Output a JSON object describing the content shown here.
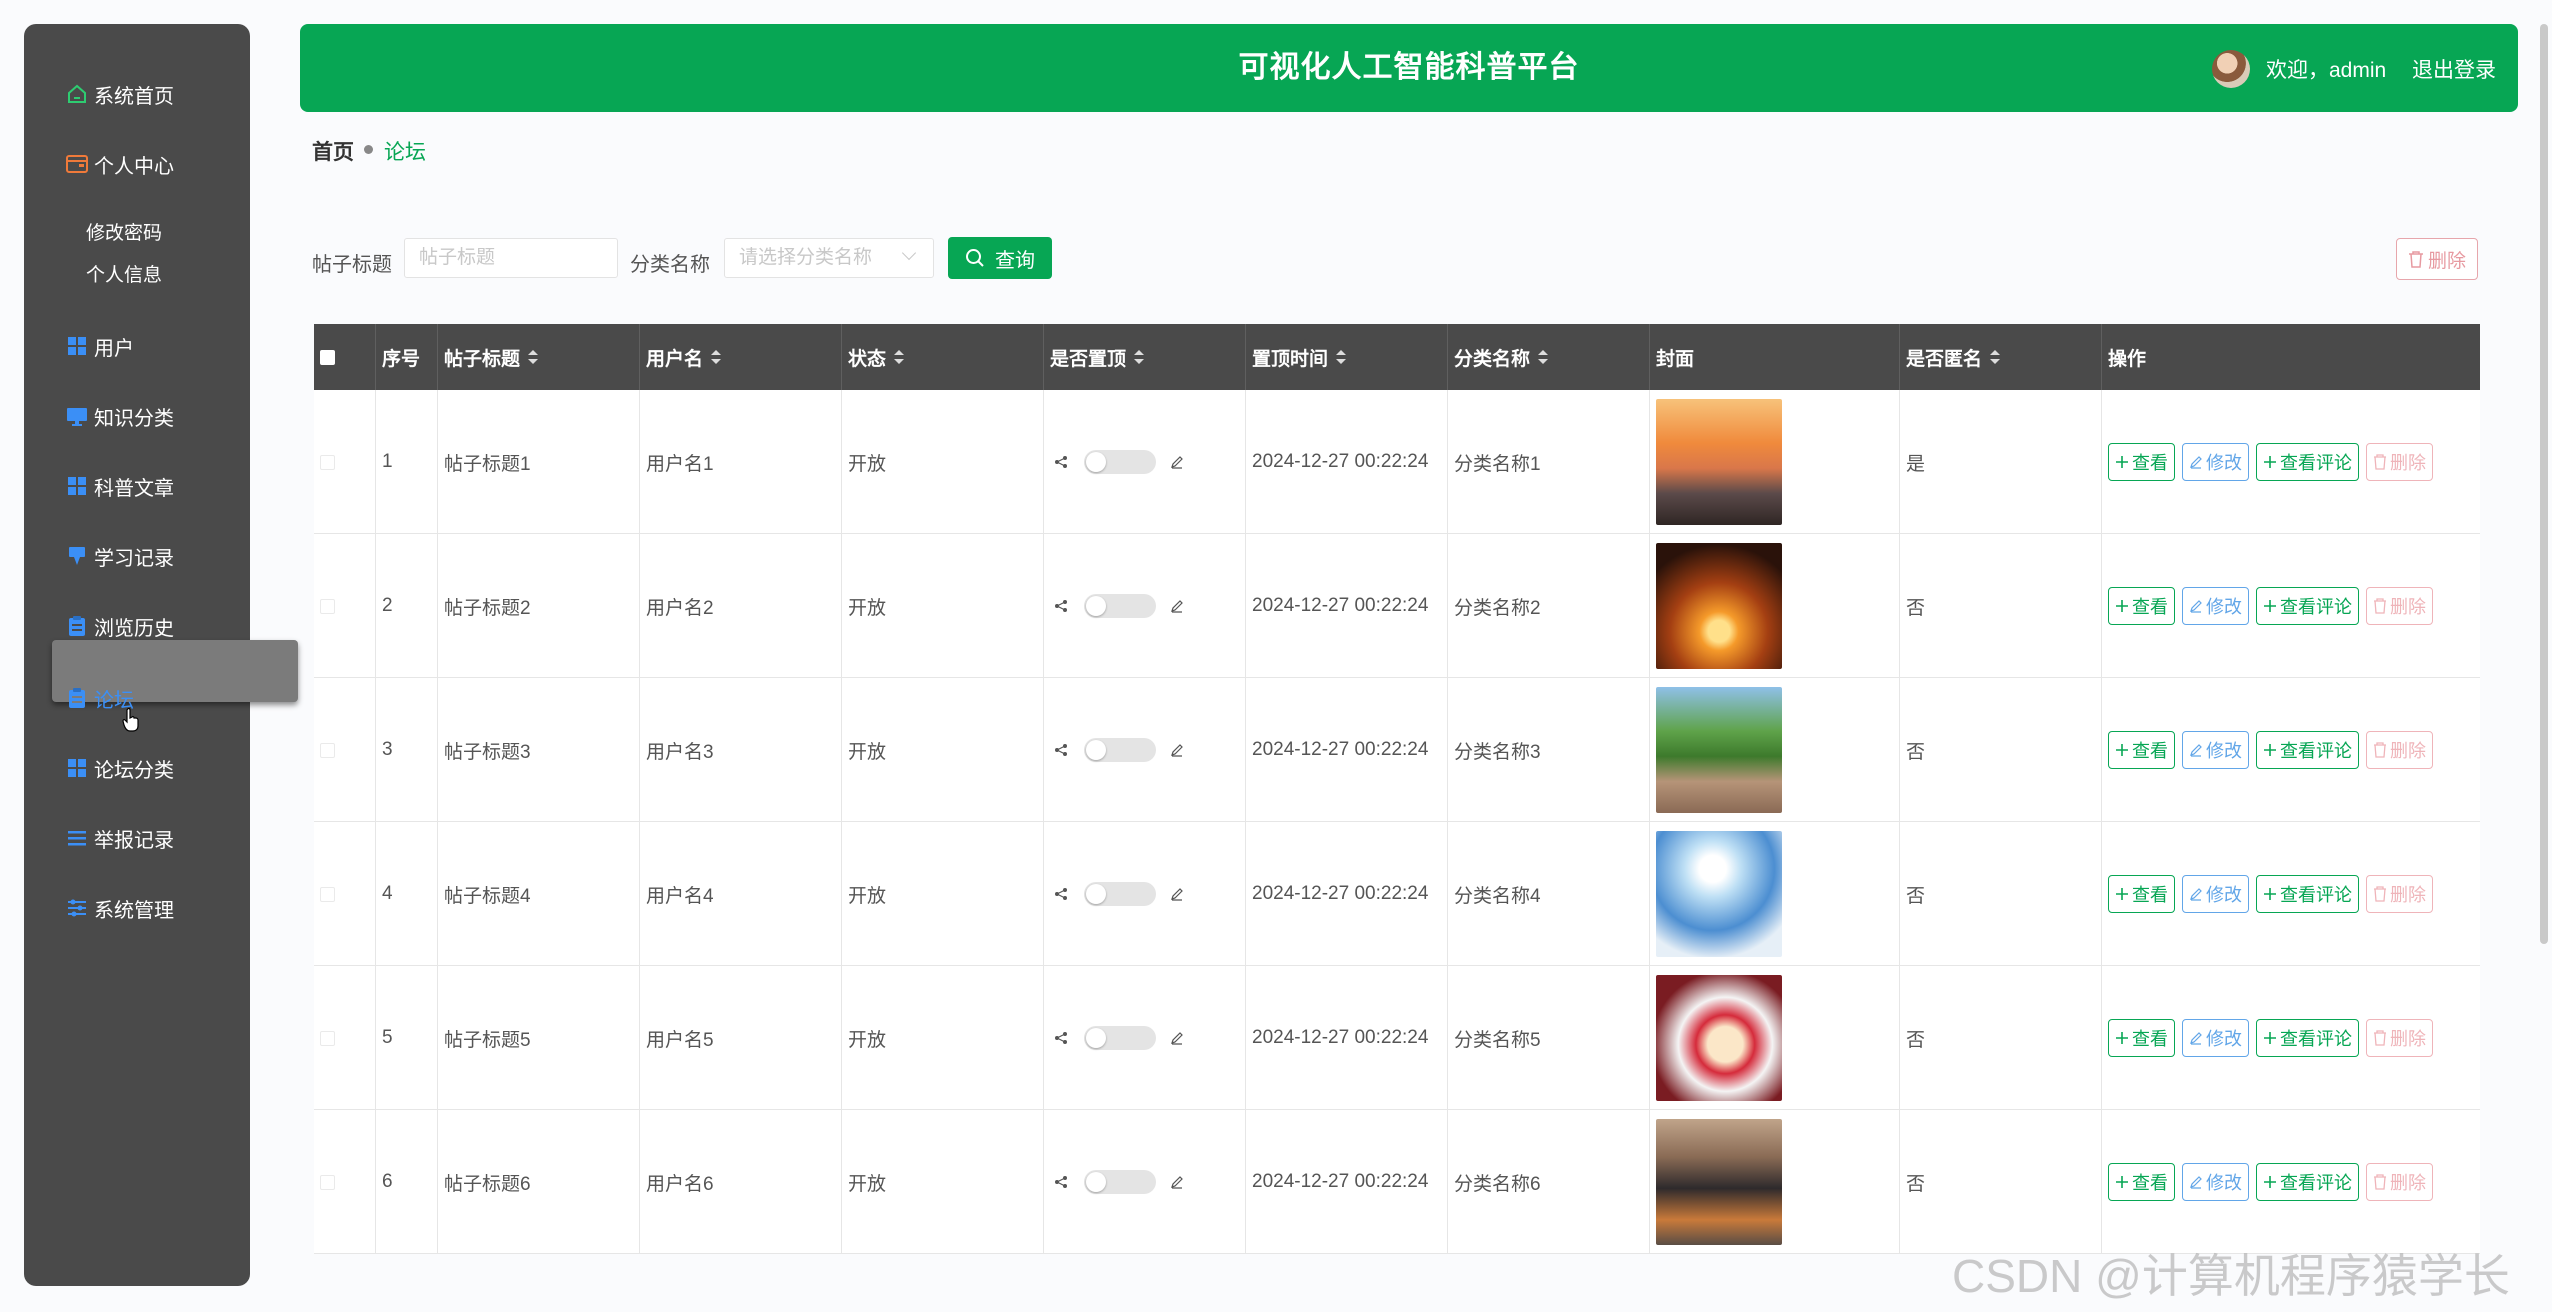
{
  "sidebar": {
    "items": [
      {
        "label": "系统首页",
        "icon": "home-icon"
      },
      {
        "label": "个人中心",
        "icon": "wallet-icon"
      },
      {
        "label": "用户",
        "icon": "grid-icon"
      },
      {
        "label": "知识分类",
        "icon": "monitor-icon"
      },
      {
        "label": "科普文章",
        "icon": "grid-icon"
      },
      {
        "label": "学习记录",
        "icon": "pin-icon"
      },
      {
        "label": "浏览历史",
        "icon": "clipboard-icon"
      },
      {
        "label": "论坛",
        "icon": "clipboard-icon"
      },
      {
        "label": "论坛分类",
        "icon": "grid-icon"
      },
      {
        "label": "举报记录",
        "icon": "list-icon"
      },
      {
        "label": "系统管理",
        "icon": "sliders-icon"
      }
    ],
    "subitems": [
      "修改密码",
      "个人信息"
    ],
    "active_index": 7
  },
  "header": {
    "title": "可视化人工智能科普平台",
    "welcome": "欢迎，admin",
    "logout": "退出登录"
  },
  "breadcrumb": {
    "home": "首页",
    "current": "论坛"
  },
  "search": {
    "title_label": "帖子标题",
    "title_placeholder": "帖子标题",
    "category_label": "分类名称",
    "category_placeholder": "请选择分类名称",
    "query_button": "查询",
    "delete_button": "删除"
  },
  "table": {
    "columns": [
      "序号",
      "帖子标题",
      "用户名",
      "状态",
      "是否置顶",
      "置顶时间",
      "分类名称",
      "封面",
      "是否匿名",
      "操作"
    ],
    "rows": [
      {
        "index": "1",
        "title": "帖子标题1",
        "user": "用户名1",
        "status": "开放",
        "time": "2024-12-27 00:22:24",
        "category": "分类名称1",
        "anonymous": "是"
      },
      {
        "index": "2",
        "title": "帖子标题2",
        "user": "用户名2",
        "status": "开放",
        "time": "2024-12-27 00:22:24",
        "category": "分类名称2",
        "anonymous": "否"
      },
      {
        "index": "3",
        "title": "帖子标题3",
        "user": "用户名3",
        "status": "开放",
        "time": "2024-12-27 00:22:24",
        "category": "分类名称3",
        "anonymous": "否"
      },
      {
        "index": "4",
        "title": "帖子标题4",
        "user": "用户名4",
        "status": "开放",
        "time": "2024-12-27 00:22:24",
        "category": "分类名称4",
        "anonymous": "否"
      },
      {
        "index": "5",
        "title": "帖子标题5",
        "user": "用户名5",
        "status": "开放",
        "time": "2024-12-27 00:22:24",
        "category": "分类名称5",
        "anonymous": "否"
      },
      {
        "index": "6",
        "title": "帖子标题6",
        "user": "用户名6",
        "status": "开放",
        "time": "2024-12-27 00:22:24",
        "category": "分类名称6",
        "anonymous": "否"
      }
    ],
    "actions": {
      "view": "查看",
      "edit": "修改",
      "comments": "查看评论",
      "delete": "删除"
    }
  },
  "watermark": "CSDN @计算机程序猿学长",
  "colors": {
    "accent": "#07a654",
    "sidebar": "#4a4a4a",
    "active_menu": "#3b8ff6",
    "edit": "#62a6e8",
    "delete": "#efb4b9"
  }
}
